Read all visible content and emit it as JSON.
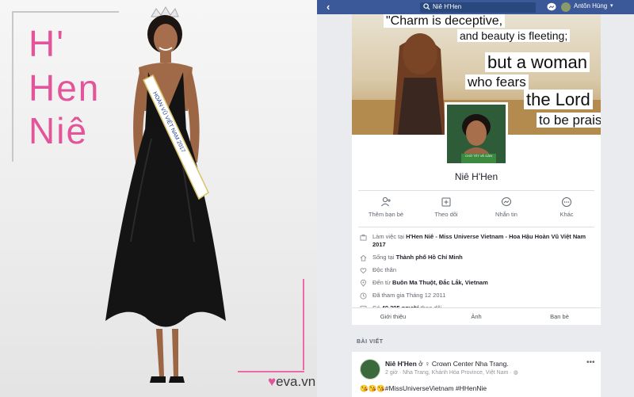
{
  "poster": {
    "title_lines": [
      "H'",
      "Hen",
      "Niê"
    ],
    "logo": "eva.vn"
  },
  "app": {
    "search_text": "Niê H'Hen",
    "user_name": "Antôn Hùng",
    "cover_quote": [
      "\"Charm is deceptive,",
      "and beauty is fleeting;",
      "but a woman",
      "who fears",
      "the Lord",
      "to be praised.\""
    ],
    "profile_badge": "CHỜ TẾT VỀ GẦN",
    "profile_name": "Niê H'Hen",
    "actions": [
      {
        "label": "Thêm bạn bè",
        "icon": "add-friend-icon"
      },
      {
        "label": "Theo dõi",
        "icon": "follow-icon"
      },
      {
        "label": "Nhắn tin",
        "icon": "messenger-icon"
      },
      {
        "label": "Khác",
        "icon": "more-icon"
      }
    ],
    "info": [
      {
        "icon": "briefcase-icon",
        "prefix": "Làm việc tại ",
        "bold": "H'Hen Niê - Miss Universe Vietnam - Hoa Hậu Hoàn Vũ Việt Nam 2017",
        "suffix": ""
      },
      {
        "icon": "home-icon",
        "prefix": "Sống tại ",
        "bold": "Thành phố Hồ Chí Minh",
        "suffix": ""
      },
      {
        "icon": "heart-icon",
        "prefix": "Độc thân",
        "bold": "",
        "suffix": ""
      },
      {
        "icon": "location-icon",
        "prefix": "Đến từ ",
        "bold": "Buôn Ma Thuột, Đắc Lắk, Vietnam",
        "suffix": ""
      },
      {
        "icon": "clock-icon",
        "prefix": "Đã tham gia Tháng 12 2011",
        "bold": "",
        "suffix": ""
      },
      {
        "icon": "followers-icon",
        "prefix": "Có ",
        "bold": "49.395 người",
        "suffix": " theo dõi"
      }
    ],
    "tabs": [
      "Giới thiệu",
      "Ảnh",
      "Bạn bè"
    ],
    "section_title": "BÀI VIẾT",
    "post": {
      "author": "Niê H'Hen",
      "checkin": " ở ♀ Crown Center Nha Trang.",
      "meta": "2 giờ · Nha Trang, Khánh Hòa Province, Việt Nam · ",
      "emoji": "😘😘😘",
      "text": "#MissUniverseVietnam #HHenNie"
    }
  }
}
